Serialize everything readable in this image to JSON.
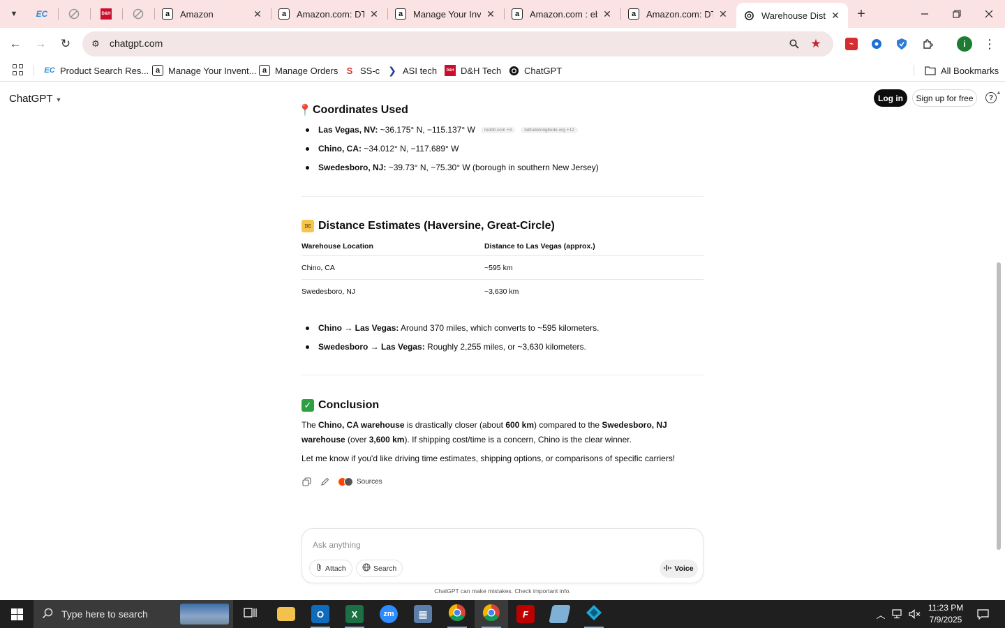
{
  "browser": {
    "tabs": [
      {
        "title": "Amazon"
      },
      {
        "title": "Amazon.com: DTE"
      },
      {
        "title": "Manage Your Inve"
      },
      {
        "title": "Amazon.com : eb"
      },
      {
        "title": "Amazon.com: DTE"
      },
      {
        "title": "Warehouse Distan"
      }
    ],
    "url": "chatgpt.com",
    "bookmarks": [
      {
        "label": "Product Search Res..."
      },
      {
        "label": "Manage Your Invent..."
      },
      {
        "label": "Manage Orders"
      },
      {
        "label": "SS-c"
      },
      {
        "label": "ASI tech"
      },
      {
        "label": "D&H Tech"
      },
      {
        "label": "ChatGPT"
      }
    ],
    "all_bookmarks": "All Bookmarks",
    "profile_initial": "i",
    "accent_color": "#fbe3e4"
  },
  "header": {
    "brand": "ChatGPT",
    "login": "Log in",
    "signup": "Sign up for free",
    "help": "?"
  },
  "section_coords": {
    "heading": "Coordinates Used",
    "items": [
      {
        "label": "Las Vegas, NV:",
        "value": " ~36.175° N, −115.137° W",
        "cites": [
          "reddit.com +3",
          "latitudelongitude.org +12"
        ]
      },
      {
        "label": "Chino, CA:",
        "value": " ~34.012° N, −117.689° W"
      },
      {
        "label": "Swedesboro, NJ:",
        "value": " ~39.73° N, −75.30° W (borough in southern New Jersey)"
      }
    ]
  },
  "section_distance": {
    "heading": "Distance Estimates (Haversine, Great-Circle)",
    "columns": [
      "Warehouse Location",
      "Distance to Las Vegas (approx.)"
    ],
    "rows": [
      [
        "Chino, CA",
        "~595 km"
      ],
      [
        "Swedesboro, NJ",
        "~3,630 km"
      ]
    ],
    "bullets": [
      {
        "label": "Chino → Las Vegas:",
        "value": " Around 370 miles, which converts to ~595 kilometers."
      },
      {
        "label": "Swedesboro → Las Vegas:",
        "value": " Roughly 2,255 miles, or ~3,630 kilometers."
      }
    ]
  },
  "section_conclusion": {
    "heading": "Conclusion",
    "p1": {
      "t1": "The ",
      "b1": "Chino, CA warehouse",
      "t2": " is drastically closer (about ",
      "b2": "600 km",
      "t3": ") compared to the ",
      "b3": "Swedesboro, NJ warehouse",
      "t4": " (over ",
      "b4": "3,600 km",
      "t5": "). If shipping cost/time is a concern, Chino is the clear winner."
    },
    "p2": "Let me know if you'd like driving time estimates, shipping options, or comparisons of specific carriers!",
    "sources": "Sources"
  },
  "composer": {
    "placeholder": "Ask anything",
    "attach": "Attach",
    "search": "Search",
    "voice": "Voice",
    "disclaimer": "ChatGPT can make mistakes. Check important info."
  },
  "taskbar": {
    "search_placeholder": "Type here to search",
    "time": "11:23 PM",
    "date": "7/9/2025"
  }
}
